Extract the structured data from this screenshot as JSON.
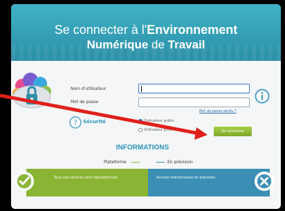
{
  "header": {
    "line1_prefix": "Se connecter à l'",
    "line1_bold": "Environnement",
    "line2_bold_a": "Numérique",
    "line2_mid": " de ",
    "line2_bold_b": "Travail"
  },
  "form": {
    "username_label": "Nom d'utilisateur",
    "password_label": "Mot de passe",
    "forgot_link": "Mot de passe perdu ?",
    "security_label": "Sécurité",
    "radio_public": "Ordinateur public",
    "radio_private": "Ordinateur privé",
    "connect_button": "Se connecter"
  },
  "info": {
    "title": "INFORMATIONS",
    "platform_label": "Plateforme",
    "forecast_label": "En prévision",
    "services_status": "Tous vos services sont opérationnels.",
    "maintenance_status": "Aucune maintenance en prévision."
  },
  "colors": {
    "banner": "#3fb2c7",
    "accent_blue": "#2d93b9",
    "green": "#8ab534",
    "annotation_arrow": "#e0201b"
  },
  "icons": [
    "cloud-lock-icon",
    "info-icon",
    "help-icon",
    "check-icon",
    "close-icon",
    "arrow-annotation"
  ]
}
